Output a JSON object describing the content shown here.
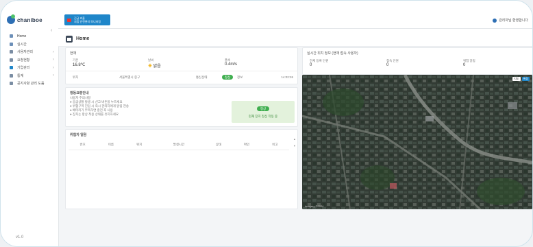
{
  "app": {
    "logo": "chaniboe"
  },
  "sidebar": {
    "items": [
      {
        "label": "Home",
        "color": "#6c8fb8",
        "arrow": false
      },
      {
        "label": "실시간",
        "color": "#6c8fb8",
        "arrow": false
      },
      {
        "label": "사용자관리",
        "color": "#7a8da3",
        "arrow": true
      },
      {
        "label": "요청현황",
        "color": "#7a8da3",
        "arrow": true
      },
      {
        "label": "기업관리",
        "color": "#1f86c9",
        "arrow": true
      },
      {
        "label": "통계",
        "color": "#7a8da3",
        "arrow": true
      },
      {
        "label": "공지사항 관리 도움",
        "color": "#7a8da3",
        "arrow": false
      }
    ],
    "footer": "v1.0"
  },
  "topbar": {
    "alert_title": "긴급 호출",
    "alert_sub": "지점 안전관리 모니터링",
    "user": "관리자님 환영합니다"
  },
  "page": {
    "title": "Home"
  },
  "weather": {
    "section": "현재",
    "fields": [
      {
        "label": "기온",
        "value": "16.8℃"
      },
      {
        "label": "날씨",
        "value": "맑음"
      },
      {
        "label": "풍속",
        "value": "0.4m/s"
      }
    ],
    "row_label": "위치",
    "row_location": "서울특별시 중구",
    "row_status_label": "통신상태",
    "row_status_badge": "정상",
    "row_extra": "정보",
    "row_time": "14:02:26"
  },
  "notice": {
    "title": "행동요령안내",
    "sub": "사용자 주의사항",
    "lines": [
      "● 응급상황 발생 시 신고 버튼을 누르세요",
      "● 위험구역 진입 시 즉시 관리자에게 알림 전송",
      "● 배터리가 부족하면 충전 후 사용",
      "● 장치는 항상 착용 상태를 유지하세요"
    ],
    "status_pill": "정상",
    "status_text": "현재 장치 정상 작동 중"
  },
  "alarm": {
    "title": "위험자 알람",
    "columns": [
      "번호",
      "이름",
      "위치",
      "발생시간",
      "상태",
      "확인",
      "비고"
    ]
  },
  "stats": {
    "title": "실시간 위치 정보 (현재 접속 사용자)",
    "items": [
      {
        "label": "전체 등록 인원",
        "value": "0"
      },
      {
        "label": "접속 인원",
        "value": "0"
      },
      {
        "label": "위험 알림",
        "value": "0"
      }
    ]
  },
  "map": {
    "btn_map": "지도",
    "btn_sat": "위성",
    "attribution": "Imagery ©2024"
  }
}
